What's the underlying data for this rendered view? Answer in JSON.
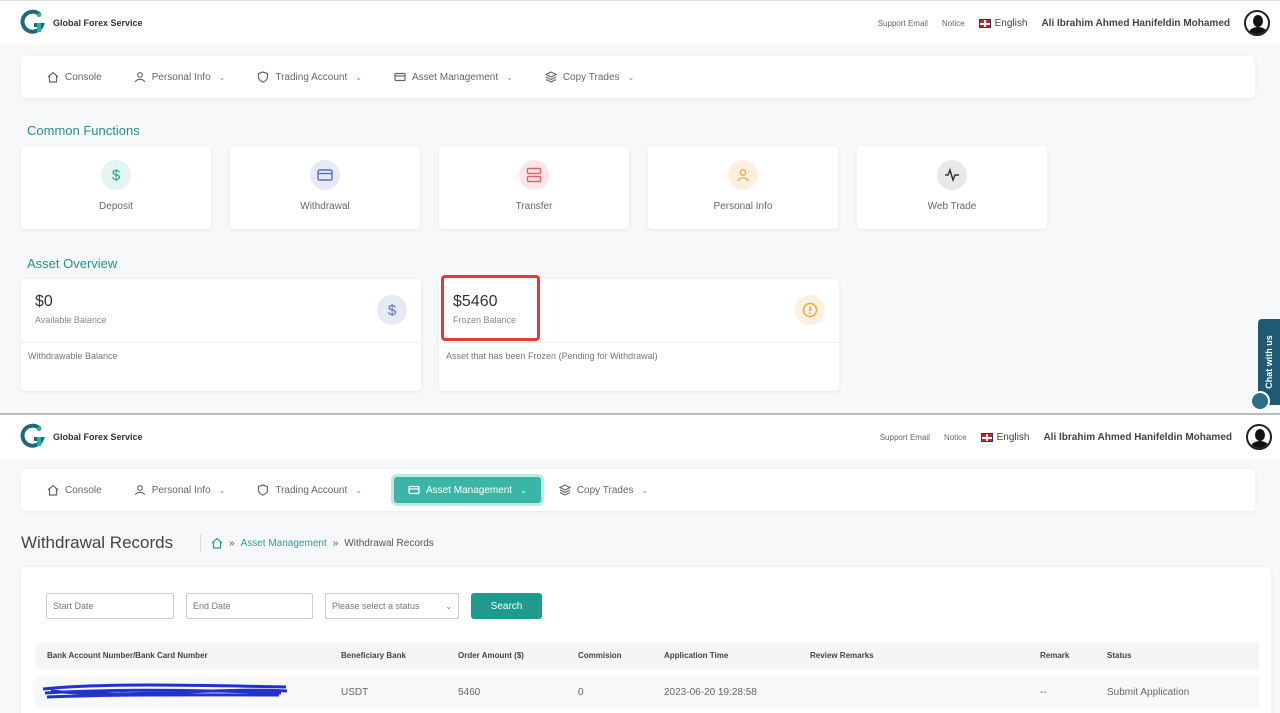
{
  "header": {
    "brand": "Global Forex Service",
    "support_email": "Support Email",
    "notice": "Notice",
    "language": "English",
    "user_name": "Ali Ibrahim Ahmed Hanifeldin Mohamed"
  },
  "nav": {
    "items": [
      {
        "label": "Console"
      },
      {
        "label": "Personal Info"
      },
      {
        "label": "Trading Account"
      },
      {
        "label": "Asset Management"
      },
      {
        "label": "Copy Trades"
      }
    ]
  },
  "common_functions": {
    "title": "Common Functions",
    "items": [
      {
        "label": "Deposit",
        "icon": "dollar-icon",
        "color": "#1fa18f"
      },
      {
        "label": "Withdrawal",
        "icon": "card-icon",
        "color": "#5a6fbf"
      },
      {
        "label": "Transfer",
        "icon": "transfer-icon",
        "color": "#e0616a"
      },
      {
        "label": "Personal Info",
        "icon": "user-icon",
        "color": "#f0a43a"
      },
      {
        "label": "Web Trade",
        "icon": "activity-icon",
        "color": "#333333"
      }
    ]
  },
  "asset_overview": {
    "title": "Asset Overview",
    "available": {
      "amount": "$0",
      "label": "Available Balance",
      "desc": "Withdrawable Balance"
    },
    "frozen": {
      "amount": "$5460",
      "label": "Frozen Balance",
      "desc": "Asset that has been Frozen (Pending for Withdrawal)"
    }
  },
  "chat": {
    "label": "Chat with us"
  },
  "withdrawal_page": {
    "title": "Withdrawal Records",
    "breadcrumb": {
      "parent": "Asset Management",
      "separator": "»",
      "current": "Withdrawal Records"
    },
    "filters": {
      "start_date": "Start Date",
      "end_date": "End Date",
      "status_placeholder": "Please select a status",
      "search_label": "Search"
    },
    "table": {
      "columns": [
        "Bank Account Number/Bank Card Number",
        "Beneficiary Bank",
        "Order Amount ($)",
        "Commision",
        "Application Time",
        "Review Remarks",
        "Remark",
        "Status"
      ],
      "rows": [
        {
          "account": "",
          "bank": "USDT",
          "amount": "5460",
          "commission": "0",
          "time": "2023-06-20 19:28:58",
          "review_remarks": "",
          "remark": "--",
          "status": "Submit Application"
        }
      ]
    }
  }
}
